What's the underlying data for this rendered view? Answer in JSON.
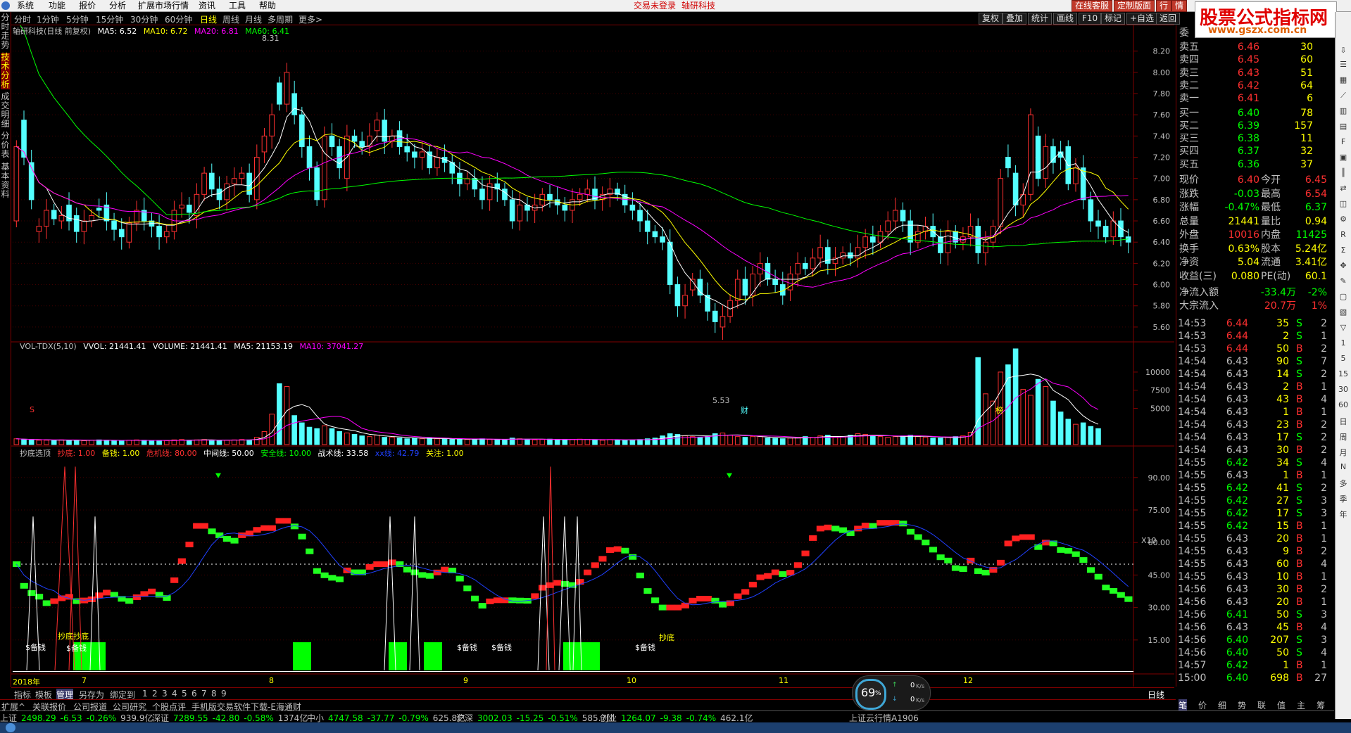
{
  "menu": [
    "系统",
    "功能",
    "报价",
    "分析",
    "扩展市场行情",
    "资讯",
    "工具",
    "帮助"
  ],
  "title_center": {
    "left": "交易未登录",
    "right": "轴研科技"
  },
  "top_right_buttons": [
    "在线客服",
    "定制版面",
    "行",
    "情"
  ],
  "watermark": {
    "line1": "股票公式指标网",
    "line2": "www.gszx.com.cn"
  },
  "periods": [
    {
      "label": "分时",
      "active": false
    },
    {
      "label": "1分钟",
      "active": false
    },
    {
      "label": "5分钟",
      "active": false
    },
    {
      "label": "15分钟",
      "active": false
    },
    {
      "label": "30分钟",
      "active": false
    },
    {
      "label": "60分钟",
      "active": false
    },
    {
      "label": "日线",
      "active": true
    },
    {
      "label": "周线",
      "active": false
    },
    {
      "label": "月线",
      "active": false
    },
    {
      "label": "多周期",
      "active": false
    },
    {
      "label": "更多>",
      "active": false
    }
  ],
  "toolbar_right": [
    "复权",
    "叠加",
    "统计",
    "画线",
    "F10",
    "标记",
    "+自选",
    "返回"
  ],
  "left_tabs": [
    {
      "label": "分时走势",
      "active": false
    },
    {
      "label": "技术分析",
      "active": true
    },
    {
      "label": "成交明细",
      "active": false
    },
    {
      "label": "分价表",
      "active": false
    },
    {
      "label": "基本资料",
      "active": false
    }
  ],
  "main_legend": {
    "stock": "轴研科技(日线 前复权)",
    "ma5": "MA5: 6.52",
    "ma10": "MA10: 6.72",
    "ma20": "MA20: 6.81",
    "ma60": "MA60: 6.41",
    "high_label": "8.31",
    "low_label": "5.53",
    "mark_cai": "财",
    "mark_bang": "榜",
    "mark_s": "S"
  },
  "vol_legend": {
    "name": "VOL-TDX(5,10)",
    "vvol": "VVOL: 21441.41",
    "volume": "VOLUME: 21441.41",
    "ma5": "MA5: 21153.19",
    "ma10": "MA10: 37041.27",
    "unit": "X10"
  },
  "ind_legend": {
    "name": "抄底选顶",
    "chaodi": "抄底: 1.00",
    "beiqian": "备钱: 1.00",
    "weiji": "危机线: 80.00",
    "zhongjian": "中间线: 50.00",
    "anquan": "安全线: 10.00",
    "zhanshu": "战术线: 33.58",
    "xxx": "xx线: 42.79",
    "guanzhu": "关注: 1.00"
  },
  "ind_labels": [
    "$备钱",
    "抄底抄底",
    "$备钱",
    "$备钱",
    "$备钱",
    "$备钱",
    "抄底"
  ],
  "date_labels": [
    "2018年",
    "7",
    "8",
    "9",
    "10",
    "11",
    "12"
  ],
  "colors": {
    "up": "#ff3030",
    "down": "#54ffff",
    "ma5": "#ffffff",
    "ma10": "#ffff00",
    "ma20": "#ff00ff",
    "ma60": "#00ff00",
    "grid": "#800000",
    "axis_text": "#c0c0c0"
  },
  "chart_data": {
    "type": "candlestick",
    "price_axis": {
      "ticks": [
        8.2,
        8.0,
        7.8,
        7.6,
        7.4,
        7.2,
        7.0,
        6.8,
        6.6,
        6.4,
        6.2,
        6.0,
        5.8,
        5.6
      ],
      "range": [
        5.5,
        8.35
      ]
    },
    "vol_axis": {
      "ticks": [
        10000,
        7500,
        5000
      ],
      "range": [
        0,
        13000
      ]
    },
    "ind_axis": {
      "ticks": [
        90.0,
        75.0,
        60.0,
        45.0,
        30.0,
        15.0
      ],
      "range": [
        0,
        100
      ]
    },
    "candles": [
      [
        6.6,
        7.3
      ],
      [
        7.55,
        7.2
      ],
      [
        7.15,
        6.8
      ],
      [
        6.5,
        6.55
      ],
      [
        6.55,
        6.7
      ],
      [
        6.7,
        6.62
      ],
      [
        6.6,
        6.65
      ],
      [
        6.75,
        6.6
      ],
      [
        6.65,
        6.5
      ],
      [
        6.5,
        6.6
      ],
      [
        6.6,
        6.65
      ],
      [
        6.72,
        6.7
      ],
      [
        6.75,
        6.6
      ],
      [
        6.6,
        6.52
      ],
      [
        6.52,
        6.45
      ],
      [
        6.4,
        6.58
      ],
      [
        6.58,
        6.7
      ],
      [
        6.7,
        6.6
      ],
      [
        6.6,
        6.55
      ],
      [
        6.55,
        6.45
      ],
      [
        6.45,
        6.5
      ],
      [
        6.5,
        6.7
      ],
      [
        6.72,
        6.75
      ],
      [
        6.75,
        6.68
      ],
      [
        6.65,
        6.85
      ],
      [
        6.85,
        7.05
      ],
      [
        7.05,
        6.9
      ],
      [
        6.9,
        6.8
      ],
      [
        6.8,
        6.95
      ],
      [
        6.95,
        7.0
      ],
      [
        7.0,
        7.05
      ],
      [
        7.05,
        6.85
      ],
      [
        6.8,
        7.2
      ],
      [
        7.25,
        7.4
      ],
      [
        7.4,
        7.6
      ],
      [
        7.9,
        7.7
      ],
      [
        7.7,
        8.0
      ],
      [
        7.8,
        7.6
      ],
      [
        7.6,
        7.3
      ],
      [
        7.3,
        7.1
      ],
      [
        7.1,
        6.8
      ],
      [
        6.8,
        7.4
      ],
      [
        7.4,
        7.3
      ],
      [
        7.3,
        7.1
      ],
      [
        7.0,
        7.4
      ],
      [
        7.4,
        7.35
      ],
      [
        7.35,
        7.3
      ],
      [
        7.3,
        7.4
      ],
      [
        7.45,
        7.55
      ],
      [
        7.55,
        7.35
      ],
      [
        7.35,
        7.4
      ],
      [
        7.45,
        7.3
      ],
      [
        7.3,
        7.25
      ],
      [
        7.25,
        7.2
      ],
      [
        7.2,
        7.25
      ],
      [
        7.25,
        7.1
      ],
      [
        7.1,
        7.2
      ],
      [
        7.2,
        7.15
      ],
      [
        7.15,
        7.05
      ],
      [
        7.05,
        6.95
      ],
      [
        6.95,
        7.0
      ],
      [
        7.0,
        6.9
      ],
      [
        6.9,
        6.8
      ],
      [
        6.8,
        6.95
      ],
      [
        6.95,
        6.9
      ],
      [
        6.9,
        6.8
      ],
      [
        6.8,
        6.6
      ],
      [
        6.6,
        6.75
      ],
      [
        6.75,
        6.7
      ],
      [
        6.7,
        6.75
      ],
      [
        6.75,
        6.85
      ],
      [
        6.85,
        6.8
      ],
      [
        6.8,
        6.75
      ],
      [
        6.75,
        6.7
      ],
      [
        6.7,
        6.8
      ],
      [
        6.8,
        6.85
      ],
      [
        6.85,
        6.9
      ],
      [
        6.9,
        6.8
      ],
      [
        6.8,
        6.85
      ],
      [
        6.85,
        6.9
      ],
      [
        6.9,
        6.85
      ],
      [
        6.85,
        6.75
      ],
      [
        6.75,
        6.7
      ],
      [
        6.7,
        6.6
      ],
      [
        6.6,
        6.5
      ],
      [
        6.5,
        6.45
      ],
      [
        6.45,
        6.4
      ],
      [
        6.4,
        6.0
      ],
      [
        6.0,
        5.8
      ],
      [
        5.8,
        5.9
      ],
      [
        5.95,
        6.05
      ],
      [
        6.05,
        5.9
      ],
      [
        5.9,
        5.75
      ],
      [
        5.75,
        5.65
      ],
      [
        5.6,
        5.7
      ],
      [
        5.7,
        5.85
      ],
      [
        5.85,
        6.05
      ],
      [
        6.05,
        5.9
      ],
      [
        5.9,
        6.1
      ],
      [
        6.1,
        6.2
      ],
      [
        6.2,
        6.05
      ],
      [
        6.05,
        6.0
      ],
      [
        6.0,
        5.9
      ],
      [
        5.95,
        6.1
      ],
      [
        6.1,
        6.2
      ],
      [
        6.2,
        6.15
      ],
      [
        6.15,
        6.25
      ],
      [
        6.25,
        6.35
      ],
      [
        6.35,
        6.2
      ],
      [
        6.2,
        6.25
      ],
      [
        6.25,
        6.3
      ],
      [
        6.3,
        6.25
      ],
      [
        6.25,
        6.35
      ],
      [
        6.35,
        6.45
      ],
      [
        6.45,
        6.4
      ],
      [
        6.4,
        6.5
      ],
      [
        6.5,
        6.6
      ],
      [
        6.6,
        6.7
      ],
      [
        6.7,
        6.6
      ],
      [
        6.6,
        6.4
      ],
      [
        6.4,
        6.5
      ],
      [
        6.5,
        6.55
      ],
      [
        6.55,
        6.45
      ],
      [
        6.45,
        6.3
      ],
      [
        6.3,
        6.5
      ],
      [
        6.5,
        6.4
      ],
      [
        6.4,
        6.45
      ],
      [
        6.45,
        6.55
      ],
      [
        6.55,
        6.3
      ],
      [
        6.3,
        6.4
      ],
      [
        6.4,
        6.55
      ],
      [
        6.55,
        7.0
      ],
      [
        7.2,
        7.1
      ],
      [
        7.05,
        6.75
      ],
      [
        6.75,
        6.85
      ],
      [
        6.85,
        7.6
      ],
      [
        7.4,
        7.0
      ],
      [
        7.0,
        7.3
      ],
      [
        7.3,
        7.15
      ],
      [
        7.25,
        7.2
      ],
      [
        7.3,
        6.95
      ],
      [
        6.95,
        7.1
      ],
      [
        7.1,
        6.8
      ],
      [
        6.8,
        6.6
      ],
      [
        6.6,
        6.55
      ],
      [
        6.55,
        6.45
      ],
      [
        6.45,
        6.6
      ],
      [
        6.6,
        6.45
      ],
      [
        6.45,
        6.4
      ]
    ],
    "volumes": [
      800,
      700,
      650,
      600,
      600,
      550,
      650,
      600,
      600,
      550,
      600,
      650,
      600,
      550,
      500,
      600,
      650,
      600,
      550,
      500,
      550,
      650,
      700,
      600,
      650,
      700,
      600,
      550,
      600,
      650,
      700,
      650,
      1000,
      1800,
      4200,
      8400,
      8000,
      4000,
      3000,
      2400,
      2200,
      2600,
      2200,
      1800,
      1600,
      1400,
      1200,
      1100,
      1300,
      1000,
      1000,
      900,
      800,
      900,
      800,
      900,
      800,
      750,
      700,
      800,
      700,
      750,
      800,
      700,
      650,
      700,
      900,
      800,
      700,
      650,
      700,
      750,
      700,
      650,
      700,
      750,
      700,
      650,
      600,
      700,
      650,
      600,
      650,
      700,
      800,
      900,
      1200,
      1500,
      1400,
      1200,
      1100,
      1000,
      1200,
      1500,
      1600,
      1300,
      1100,
      1000,
      1100,
      1100,
      900,
      850,
      800,
      900,
      1000,
      1100,
      1000,
      1200,
      1300,
      1000,
      1100,
      1300,
      1500,
      1400,
      1200,
      1100,
      1000,
      1100,
      1200,
      1300,
      1100,
      1000,
      900,
      900,
      1000,
      1100,
      1200,
      1700,
      12000,
      7000,
      6000,
      10000,
      11000,
      13200,
      7600,
      6800,
      9000,
      8000,
      6000,
      4500,
      3500,
      2800,
      3000,
      2500,
      2200
    ]
  },
  "orderbook": {
    "header": "委",
    "sell": [
      {
        "label": "卖五",
        "price": "6.46",
        "vol": "30"
      },
      {
        "label": "卖四",
        "price": "6.45",
        "vol": "60"
      },
      {
        "label": "卖三",
        "price": "6.43",
        "vol": "51"
      },
      {
        "label": "卖二",
        "price": "6.42",
        "vol": "64"
      },
      {
        "label": "卖一",
        "price": "6.41",
        "vol": "6"
      }
    ],
    "buy": [
      {
        "label": "买一",
        "price": "6.40",
        "vol": "78"
      },
      {
        "label": "买二",
        "price": "6.39",
        "vol": "157"
      },
      {
        "label": "买三",
        "price": "6.38",
        "vol": "11"
      },
      {
        "label": "买四",
        "price": "6.37",
        "vol": "32"
      },
      {
        "label": "买五",
        "price": "6.36",
        "vol": "37"
      }
    ],
    "stats": [
      {
        "l1": "现价",
        "v1": "6.40",
        "l2": "今开",
        "v2": "6.45",
        "c1": "#ff3030",
        "c2": "#ff3030"
      },
      {
        "l1": "涨跌",
        "v1": "-0.03",
        "l2": "最高",
        "v2": "6.54",
        "c1": "#00ff00",
        "c2": "#ff3030"
      },
      {
        "l1": "涨幅",
        "v1": "-0.47%",
        "l2": "最低",
        "v2": "6.37",
        "c1": "#00ff00",
        "c2": "#00ff00"
      },
      {
        "l1": "总量",
        "v1": "21441",
        "l2": "量比",
        "v2": "0.94",
        "c1": "#ffff00",
        "c2": "#ffff00"
      },
      {
        "l1": "外盘",
        "v1": "10016",
        "l2": "内盘",
        "v2": "11425",
        "c1": "#ff3030",
        "c2": "#00ff00"
      },
      {
        "l1": "换手",
        "v1": "0.63%",
        "l2": "股本",
        "v2": "5.24亿",
        "c1": "#ffff00",
        "c2": "#ffff00"
      },
      {
        "l1": "净资",
        "v1": "5.04",
        "l2": "流通",
        "v2": "3.41亿",
        "c1": "#ffff00",
        "c2": "#ffff00"
      },
      {
        "l1": "收益(三)",
        "v1": "0.080",
        "l2": "PE(动)",
        "v2": "60.1",
        "c1": "#ffff00",
        "c2": "#ffff00"
      }
    ],
    "flow": [
      {
        "label": "净流入额",
        "v1": "-33.4万",
        "v2": "-2%"
      },
      {
        "label": "大宗流入",
        "v1": "20.7万",
        "v2": "1%"
      }
    ],
    "ticks": [
      [
        "14:53",
        "6.44",
        "35",
        "S",
        "2"
      ],
      [
        "14:53",
        "6.44",
        "2",
        "S",
        "1"
      ],
      [
        "14:53",
        "6.44",
        "50",
        "B",
        "2"
      ],
      [
        "14:54",
        "6.43",
        "90",
        "S",
        "7"
      ],
      [
        "14:54",
        "6.43",
        "14",
        "S",
        "2"
      ],
      [
        "14:54",
        "6.43",
        "2",
        "B",
        "1"
      ],
      [
        "14:54",
        "6.43",
        "43",
        "B",
        "4"
      ],
      [
        "14:54",
        "6.43",
        "1",
        "B",
        "1"
      ],
      [
        "14:54",
        "6.43",
        "23",
        "B",
        "2"
      ],
      [
        "14:54",
        "6.43",
        "17",
        "S",
        "2"
      ],
      [
        "14:54",
        "6.43",
        "30",
        "B",
        "2"
      ],
      [
        "14:55",
        "6.42",
        "34",
        "S",
        "4"
      ],
      [
        "14:55",
        "6.43",
        "1",
        "B",
        "1"
      ],
      [
        "14:55",
        "6.42",
        "41",
        "S",
        "2"
      ],
      [
        "14:55",
        "6.42",
        "27",
        "S",
        "3"
      ],
      [
        "14:55",
        "6.42",
        "17",
        "S",
        "3"
      ],
      [
        "14:55",
        "6.42",
        "15",
        "B",
        "1"
      ],
      [
        "14:55",
        "6.43",
        "20",
        "B",
        "1"
      ],
      [
        "14:55",
        "6.43",
        "9",
        "B",
        "2"
      ],
      [
        "14:55",
        "6.43",
        "60",
        "B",
        "4"
      ],
      [
        "14:55",
        "6.43",
        "10",
        "B",
        "1"
      ],
      [
        "14:56",
        "6.43",
        "30",
        "B",
        "2"
      ],
      [
        "14:56",
        "6.43",
        "20",
        "B",
        "1"
      ],
      [
        "14:56",
        "6.41",
        "50",
        "S",
        "3"
      ],
      [
        "14:56",
        "6.43",
        "45",
        "B",
        "4"
      ],
      [
        "14:56",
        "6.40",
        "207",
        "S",
        "3"
      ],
      [
        "14:56",
        "6.40",
        "50",
        "S",
        "4"
      ],
      [
        "14:57",
        "6.42",
        "1",
        "B",
        "1"
      ],
      [
        "15:00",
        "6.40",
        "698",
        "B",
        "27"
      ]
    ]
  },
  "bottom_tabs": [
    "指标",
    "模板",
    "管理",
    "另存为",
    "绑定到",
    "1",
    "2",
    "3",
    "4",
    "5",
    "6",
    "7",
    "8",
    "9"
  ],
  "bottom_right_label": "日线",
  "bottom_bar2": [
    "扩展^",
    "关联报价",
    "公司报道",
    "公司研究",
    "个股点评",
    "手机版交易软件下载-E海通财"
  ],
  "right_bottom_tabs": [
    "笔",
    "价",
    "细",
    "势",
    "联",
    "值",
    "主",
    "筹"
  ],
  "status": [
    {
      "name": "上证",
      "v": "2498.29",
      "d": "-6.53",
      "p": "-0.26%",
      "a": "939.9亿"
    },
    {
      "name": "深证",
      "v": "7289.55",
      "d": "-42.80",
      "p": "-0.58%",
      "a": "1374亿"
    },
    {
      "name": "中小",
      "v": "4747.58",
      "d": "-37.77",
      "p": "-0.79%",
      "a": "625.8亿"
    },
    {
      "name": "沪深",
      "v": "3002.03",
      "d": "-15.25",
      "p": "-0.51%",
      "a": "585.7亿"
    },
    {
      "name": "创业",
      "v": "1264.07",
      "d": "-9.38",
      "p": "-0.74%",
      "a": "462.1亿"
    }
  ],
  "status_right": "上证云行情A1906",
  "gauge": {
    "percent": "69",
    "unit": "%",
    "up": "0",
    "down": "0",
    "speed_unit": "K/s"
  }
}
